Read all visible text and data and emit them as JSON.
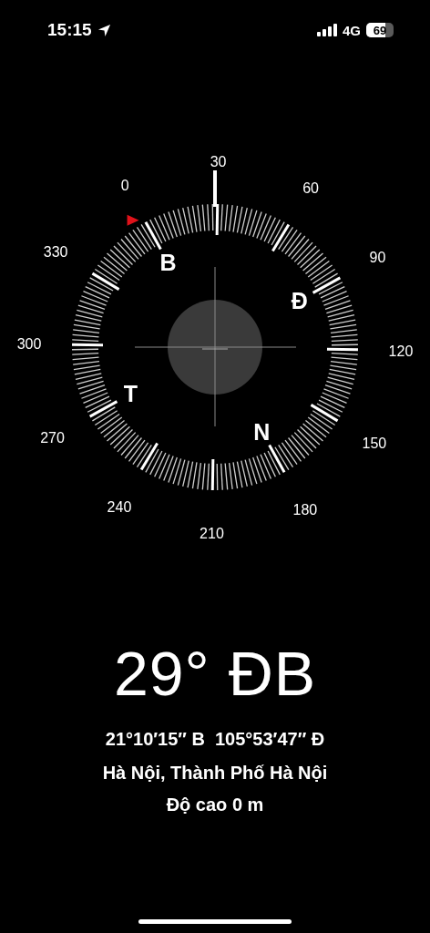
{
  "status_bar": {
    "time": "15:15",
    "network": "4G",
    "battery": "69"
  },
  "compass": {
    "degree_labels": [
      "0",
      "30",
      "60",
      "90",
      "120",
      "150",
      "180",
      "210",
      "240",
      "270",
      "300",
      "330"
    ],
    "cardinal_labels": [
      "B",
      "Đ",
      "N",
      "T"
    ]
  },
  "heading": "29° ĐB",
  "coordinates": "21°10′15″ B  105°53′47″ Đ",
  "location": "Hà Nội, Thành Phố Hà Nội",
  "altitude": "Độ cao 0 m"
}
